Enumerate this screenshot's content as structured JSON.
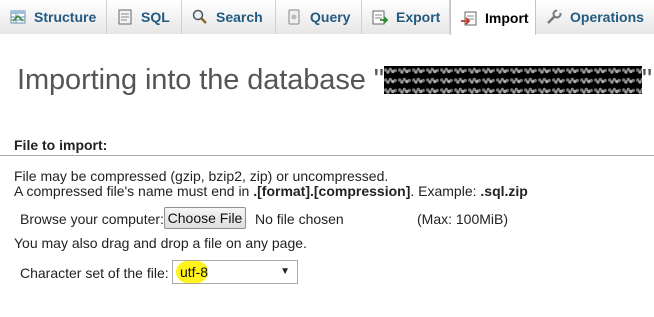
{
  "tabs": [
    {
      "label": "Structure",
      "icon": "structure-icon"
    },
    {
      "label": "SQL",
      "icon": "sql-icon"
    },
    {
      "label": "Search",
      "icon": "search-icon"
    },
    {
      "label": "Query",
      "icon": "query-icon"
    },
    {
      "label": "Export",
      "icon": "export-icon"
    },
    {
      "label": "Import",
      "icon": "import-icon",
      "active": true
    },
    {
      "label": "Operations",
      "icon": "operations-icon"
    }
  ],
  "page": {
    "heading_prefix": "Importing into the database \"",
    "heading_suffix": "\""
  },
  "file_section": {
    "title": "File to import:",
    "line1": "File may be compressed (gzip, bzip2, zip) or uncompressed.",
    "line2_prefix": "A compressed file's name must end in ",
    "line2_bold": ".[format].[compression]",
    "line2_mid": ". Example: ",
    "line2_example": ".sql.zip",
    "browse_label": "Browse your computer:",
    "choose_button": "Choose File",
    "no_file": "No file chosen",
    "max_size": "(Max: 100MiB)",
    "drag_hint": "You may also drag and drop a file on any page.",
    "charset_label": "Character set of the file:",
    "charset_value": "utf-8"
  },
  "colors": {
    "tab_text": "#235a81",
    "highlight": "#fff200"
  }
}
